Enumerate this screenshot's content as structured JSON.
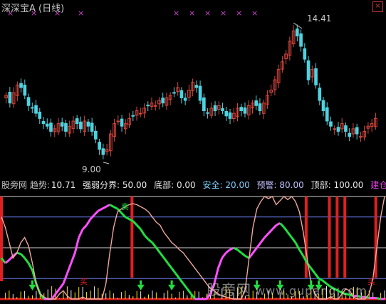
{
  "window": {
    "title": "深深宝A",
    "period": "(日线)",
    "close_glyph": "×"
  },
  "price_annotations": {
    "high_label": "14.41",
    "low_label": "9.00"
  },
  "indicator_header": {
    "name": "股旁网 趋势:",
    "trend_value": "10.71",
    "strength_line": "强弱分界: 50.00",
    "bottom": "底部: 0.00",
    "safe": "安全: 20.00",
    "warn": "预警: 80.00",
    "top": "顶部: 100.00",
    "build": "建仓"
  },
  "signals": {
    "sell": "卖",
    "buy": "买"
  },
  "watermark": {
    "site": "股旁网",
    "url": "www.gupang.com"
  },
  "colors": {
    "background": "#000000",
    "up_candle": "#d9463c",
    "down_candle": "#4fd2e0",
    "magenta_marker": "#cc44cc",
    "trend_line": "#f0a89c",
    "ref_line_blue": "#6a7cf0",
    "ref_line_white": "#d0d0d0",
    "signal_red": "#e02020",
    "green": "#20e040",
    "pink": "#ff50ff",
    "yellow": "#ffe000"
  },
  "chart_data": [
    {
      "type": "candlestick",
      "title": "深深宝A (日线)",
      "ylim": [
        8.5,
        14.8
      ],
      "high": {
        "value": 14.41
      },
      "low": {
        "value": 9.0
      },
      "closes": [
        11.6,
        11.3,
        11.7,
        12.0,
        11.9,
        11.6,
        11.2,
        11.1,
        10.9,
        10.7,
        10.5,
        10.4,
        10.2,
        10.3,
        10.5,
        10.4,
        10.2,
        10.4,
        10.6,
        10.5,
        10.3,
        10.6,
        10.4,
        10.2,
        9.9,
        9.5,
        9.3,
        9.5,
        10.1,
        10.5,
        10.6,
        10.4,
        10.5,
        10.7,
        10.8,
        11.0,
        10.9,
        11.1,
        11.2,
        11.3,
        11.2,
        11.4,
        11.3,
        11.5,
        11.6,
        11.7,
        11.9,
        11.5,
        11.4,
        11.8,
        12.1,
        11.9,
        11.4,
        11.0,
        10.9,
        11.1,
        11.0,
        11.2,
        11.0,
        10.8,
        10.7,
        10.9,
        11.1,
        11.0,
        10.9,
        11.2,
        11.3,
        11.2,
        11.0,
        11.3,
        11.6,
        11.8,
        12.2,
        12.6,
        12.9,
        13.2,
        13.7,
        14.1,
        13.9,
        13.5,
        13.0,
        12.2,
        12.6,
        12.0,
        11.4,
        11.0,
        10.6,
        10.4,
        10.3,
        10.2,
        10.5,
        10.2,
        10.0,
        10.3,
        10.1,
        10.0,
        10.2,
        10.4,
        10.5,
        10.7
      ],
      "markers_top_count": 10
    },
    {
      "type": "indicator",
      "name": "股旁网 趋势",
      "trend_value": 10.71,
      "levels": {
        "bottom": 0,
        "safe": 20,
        "strength": 50,
        "warn": 80,
        "top": 100
      },
      "ylim": [
        0,
        100
      ],
      "trend": [
        80,
        70,
        55,
        40,
        45,
        55,
        60,
        52,
        35,
        15,
        5,
        2,
        0,
        0,
        0,
        5,
        8,
        3,
        0,
        0,
        0,
        2,
        0,
        0,
        0,
        0,
        0,
        15,
        45,
        70,
        85,
        88,
        90,
        92,
        93,
        92,
        90,
        88,
        85,
        80,
        75,
        72,
        65,
        60,
        55,
        52,
        48,
        45,
        40,
        35,
        30,
        25,
        20,
        15,
        10,
        8,
        5,
        3,
        2,
        1,
        0,
        0,
        0,
        10,
        40,
        70,
        88,
        95,
        100,
        98,
        100,
        92,
        96,
        100,
        97,
        100,
        95,
        85,
        65,
        40,
        15,
        5,
        0,
        0,
        0,
        2,
        0,
        0,
        5,
        10,
        8,
        2,
        0,
        0,
        0,
        5,
        20,
        50,
        80,
        100
      ],
      "osc": [
        40,
        35,
        38,
        42,
        45,
        44,
        40,
        35,
        28,
        15,
        5,
        0,
        0,
        0,
        5,
        10,
        15,
        25,
        35,
        45,
        60,
        68,
        72,
        78,
        82,
        86,
        88,
        90,
        92,
        90,
        88,
        84,
        80,
        78,
        76,
        72,
        68,
        62,
        58,
        55,
        50,
        45,
        40,
        35,
        30,
        25,
        20,
        15,
        10,
        5,
        0,
        0,
        0,
        0,
        5,
        15,
        30,
        40,
        45,
        48,
        50,
        48,
        45,
        42,
        40,
        45,
        50,
        55,
        60,
        64,
        68,
        72,
        74,
        70,
        65,
        60,
        55,
        48,
        42,
        35,
        30,
        25,
        20,
        18,
        15,
        12,
        10,
        8,
        6,
        5,
        4,
        3,
        3,
        2,
        2,
        1,
        1,
        1,
        0,
        0
      ]
    }
  ]
}
